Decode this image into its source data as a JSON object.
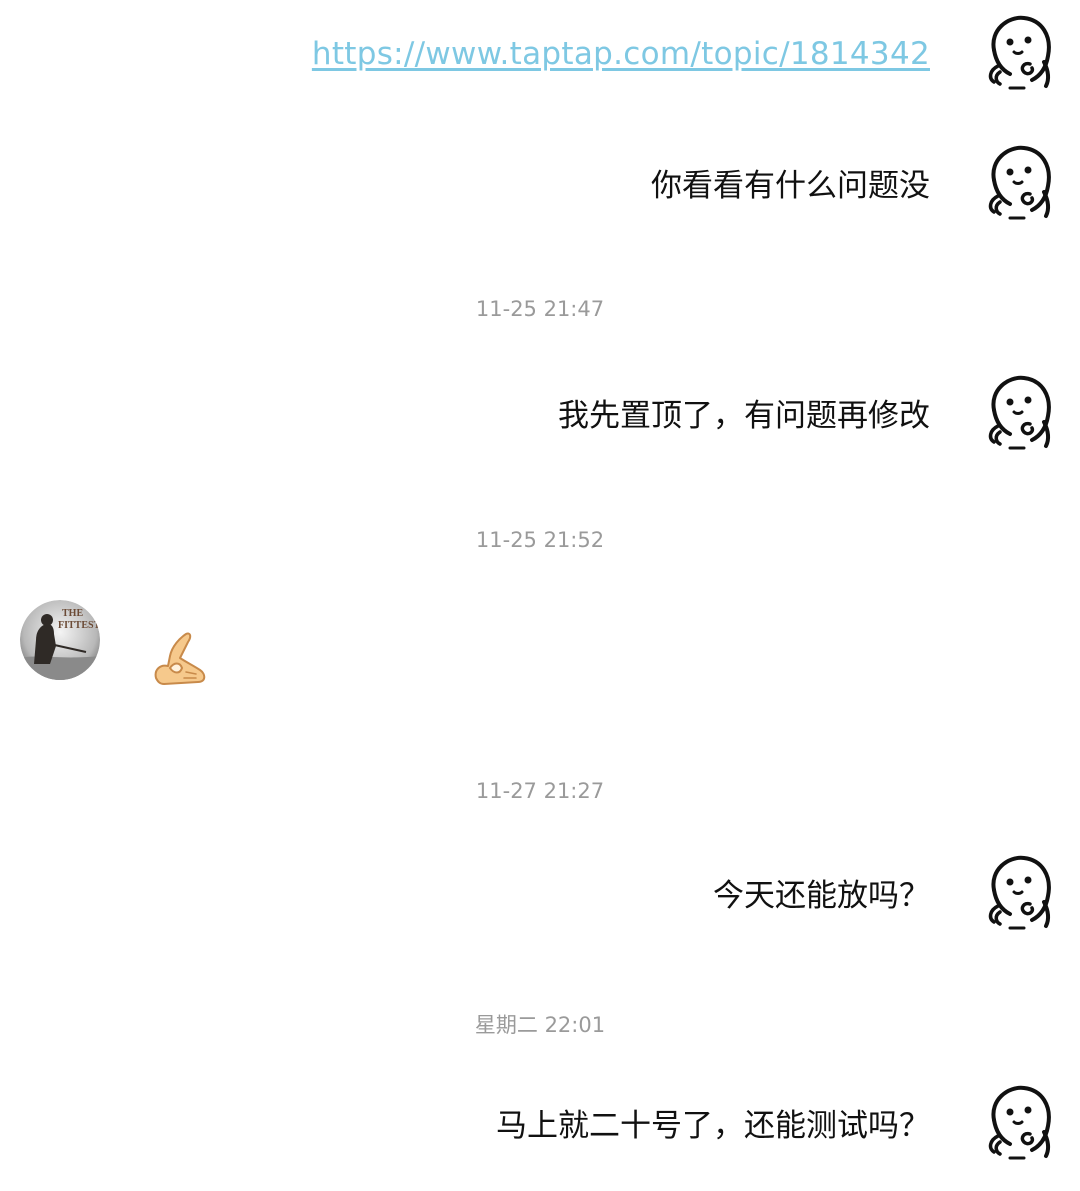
{
  "messages": [
    {
      "side": "right",
      "type": "link",
      "text": "https://www.taptap.com/topic/1814342"
    },
    {
      "side": "right",
      "type": "text",
      "text": "你看看有什么问题没"
    },
    {
      "type": "time",
      "text": "11-25 21:47"
    },
    {
      "side": "right",
      "type": "text",
      "text": "我先置顶了，有问题再修改"
    },
    {
      "type": "time",
      "text": "11-25 21:52"
    },
    {
      "side": "left",
      "type": "emoji",
      "emoji": "ok-hand-sticker"
    },
    {
      "type": "time",
      "text": "11-27 21:27"
    },
    {
      "side": "right",
      "type": "text",
      "text": "今天还能放吗？"
    },
    {
      "type": "time",
      "text": "星期二 22:01"
    },
    {
      "side": "right",
      "type": "text",
      "text": "马上就二十号了，还能测试吗？"
    }
  ],
  "other_avatar": {
    "logo_line1": "THE",
    "logo_line2": "FITTEST"
  },
  "colors": {
    "link": "#7ec8e3",
    "timestamp": "#9a9a9a",
    "text": "#111111"
  }
}
